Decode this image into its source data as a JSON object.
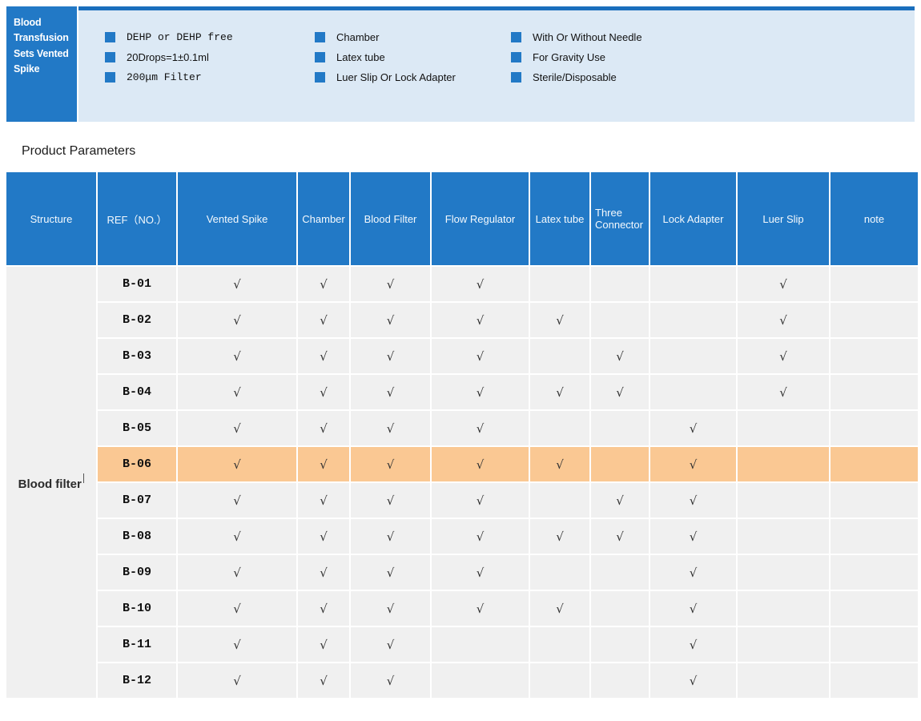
{
  "header": {
    "tab_title": "Blood Transfusion Sets Vented Spike",
    "features": {
      "columns": [
        {
          "items": [
            "DEHP or DEHP free",
            "20Drops=1±0.1ml",
            "200μm Filter"
          ]
        },
        {
          "items": [
            "Chamber",
            "Latex tube",
            "Luer Slip Or Lock Adapter"
          ]
        },
        {
          "items": [
            "With Or Without Needle",
            "For Gravity Use",
            "Sterile/Disposable"
          ]
        }
      ]
    }
  },
  "section_title": "Product Parameters",
  "table": {
    "columns": [
      "Structure",
      "REF（NO.）",
      "Vented Spike",
      "Chamber",
      "Blood Filter",
      "Flow Regulator",
      "Latex tube",
      "Three Connector",
      "Lock Adapter",
      "Luer Slip",
      "note"
    ],
    "structure_label": "Blood filter",
    "check_glyph": "√",
    "rows": [
      {
        "ref": "B-01",
        "highlight": false,
        "checks": [
          1,
          1,
          1,
          1,
          0,
          0,
          0,
          1,
          0
        ]
      },
      {
        "ref": "B-02",
        "highlight": false,
        "checks": [
          1,
          1,
          1,
          1,
          1,
          0,
          0,
          1,
          0
        ]
      },
      {
        "ref": "B-03",
        "highlight": false,
        "checks": [
          1,
          1,
          1,
          1,
          0,
          1,
          0,
          1,
          0
        ]
      },
      {
        "ref": "B-04",
        "highlight": false,
        "checks": [
          1,
          1,
          1,
          1,
          1,
          1,
          0,
          1,
          0
        ]
      },
      {
        "ref": "B-05",
        "highlight": false,
        "checks": [
          1,
          1,
          1,
          1,
          0,
          0,
          1,
          0,
          0
        ]
      },
      {
        "ref": "B-06",
        "highlight": true,
        "checks": [
          1,
          1,
          1,
          1,
          1,
          0,
          1,
          0,
          0
        ]
      },
      {
        "ref": "B-07",
        "highlight": false,
        "checks": [
          1,
          1,
          1,
          1,
          0,
          1,
          1,
          0,
          0
        ]
      },
      {
        "ref": "B-08",
        "highlight": false,
        "checks": [
          1,
          1,
          1,
          1,
          1,
          1,
          1,
          0,
          0
        ]
      },
      {
        "ref": "B-09",
        "highlight": false,
        "checks": [
          1,
          1,
          1,
          1,
          0,
          0,
          1,
          0,
          0
        ]
      },
      {
        "ref": "B-10",
        "highlight": false,
        "checks": [
          1,
          1,
          1,
          1,
          1,
          0,
          1,
          0,
          0
        ]
      },
      {
        "ref": "B-11",
        "highlight": false,
        "checks": [
          1,
          1,
          1,
          0,
          0,
          0,
          1,
          0,
          0
        ]
      },
      {
        "ref": "B-12",
        "highlight": false,
        "checks": [
          1,
          1,
          1,
          0,
          0,
          0,
          1,
          0,
          0
        ]
      }
    ]
  },
  "colors": {
    "accent": "#2279c6",
    "banner": "#dce9f5",
    "strip": "#1a6ebc",
    "cell": "#f0f0f0",
    "highlight": "#fac893",
    "check": "#333333"
  }
}
